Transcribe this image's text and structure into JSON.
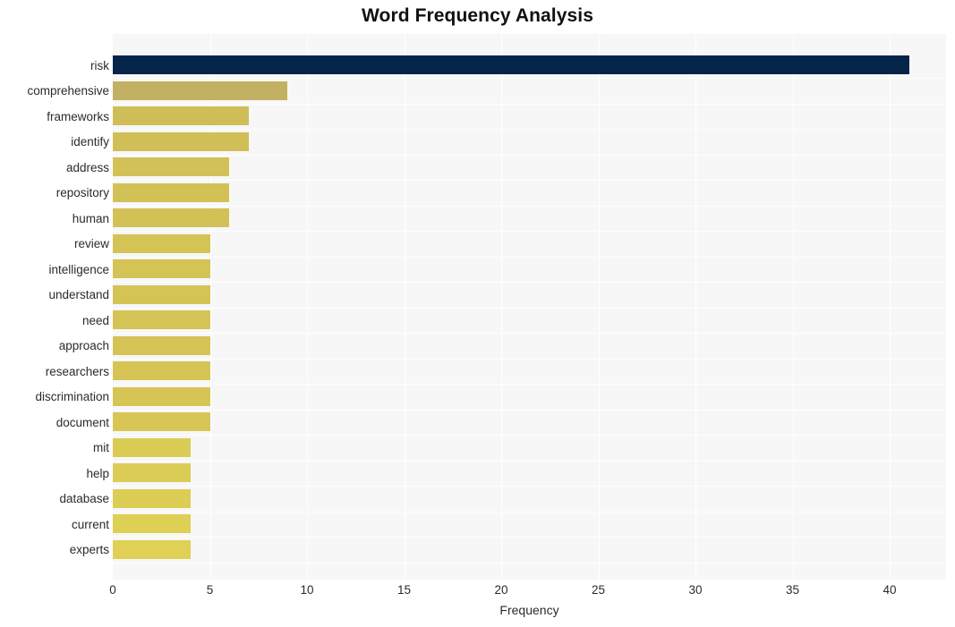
{
  "chart_data": {
    "type": "bar",
    "orientation": "horizontal",
    "title": "Word Frequency Analysis",
    "xlabel": "Frequency",
    "ylabel": "",
    "xlim": [
      0,
      42.9
    ],
    "xticks": [
      0,
      5,
      10,
      15,
      20,
      25,
      30,
      35,
      40
    ],
    "xtick_labels": [
      "0",
      "5",
      "10",
      "15",
      "20",
      "25",
      "30",
      "35",
      "40"
    ],
    "grid": "vertical",
    "legend": "none",
    "categories": [
      "risk",
      "comprehensive",
      "frameworks",
      "identify",
      "address",
      "repository",
      "human",
      "review",
      "intelligence",
      "understand",
      "need",
      "approach",
      "researchers",
      "discrimination",
      "document",
      "mit",
      "help",
      "database",
      "current",
      "experts"
    ],
    "values": [
      41,
      9,
      7,
      7,
      6,
      6,
      6,
      5,
      5,
      5,
      5,
      5,
      5,
      5,
      5,
      4,
      4,
      4,
      4,
      4
    ],
    "bar_colors": [
      "#042449",
      "#c2b163",
      "#cfbe58",
      "#d0bf57",
      "#d2c156",
      "#d2c156",
      "#d2c156",
      "#d4c355",
      "#d4c355",
      "#d4c355",
      "#d5c455",
      "#d5c455",
      "#d6c555",
      "#d6c555",
      "#d7c655",
      "#dacb55",
      "#dbcc55",
      "#dccd55",
      "#decf55",
      "#e0d055"
    ]
  },
  "colors": {
    "plot_background": "#f7f7f7",
    "page_background": "#ffffff",
    "gridline": "#ffffff",
    "title_text": "#111111",
    "axis_text": "#2b2b2b",
    "highlight_bar": "#042449",
    "accent_bar": "#d4c355"
  }
}
